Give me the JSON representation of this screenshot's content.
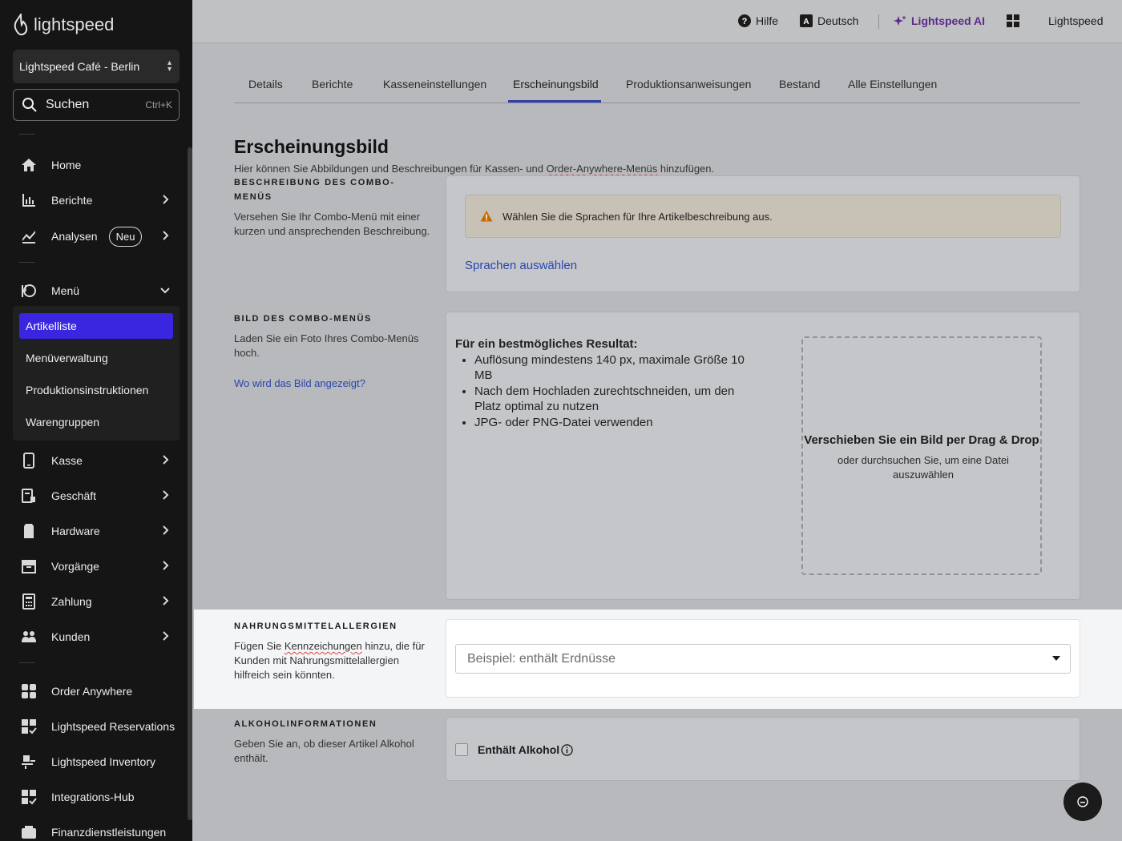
{
  "sidebar": {
    "logo_text": "lightspeed",
    "store_selector": "Lightspeed Café - Berlin",
    "search_label": "Suchen",
    "search_shortcut": "Ctrl+K",
    "items": [
      {
        "label": "Home"
      },
      {
        "label": "Berichte"
      },
      {
        "label": "Analysen",
        "badge": "Neu"
      },
      {
        "label": "Menü"
      },
      {
        "label": "Kasse"
      },
      {
        "label": "Geschäft"
      },
      {
        "label": "Hardware"
      },
      {
        "label": "Vorgänge"
      },
      {
        "label": "Zahlung"
      },
      {
        "label": "Kunden"
      },
      {
        "label": "Order Anywhere"
      },
      {
        "label": "Lightspeed Reservations"
      },
      {
        "label": "Lightspeed Inventory"
      },
      {
        "label": "Integrations-Hub"
      },
      {
        "label": "Finanzdienstleistungen"
      }
    ],
    "submenu": [
      {
        "label": "Artikelliste",
        "active": true
      },
      {
        "label": "Menüverwaltung"
      },
      {
        "label": "Produktionsinstruktionen"
      },
      {
        "label": "Warengruppen"
      }
    ]
  },
  "topbar": {
    "help": "Hilfe",
    "language": "Deutsch",
    "ai": "Lightspeed AI",
    "account": "Lightspeed"
  },
  "tabs": [
    "Details",
    "Berichte",
    "Kasseneinstellungen",
    "Erscheinungsbild",
    "Produktionsanweisungen",
    "Bestand",
    "Alle Einstellungen"
  ],
  "active_tab": "Erscheinungsbild",
  "page": {
    "title": "Erscheinungsbild",
    "subtitle_pre": "Hier können Sie Abbildungen und Beschreibungen für Kassen- und ",
    "subtitle_link": "Order-Anywhere-Menüs",
    "subtitle_post": " hinzufügen."
  },
  "sections": {
    "description": {
      "title": "BESCHREIBUNG DES COMBO-MENÜS",
      "desc": "Versehen Sie Ihr Combo-Menü mit einer kurzen und ansprechenden Beschreibung.",
      "warning": "Wählen Sie die Sprachen für Ihre Artikelbeschreibung aus.",
      "link": "Sprachen auswählen"
    },
    "image": {
      "title": "BILD DES COMBO-MENÜS",
      "desc": "Laden Sie ein Foto Ihres Combo-Menüs hoch.",
      "link": "Wo wird das Bild angezeigt?",
      "tips_title": "Für ein bestmögliches Resultat:",
      "tips": [
        "Auflösung mindestens 140 px, maximale Größe 10 MB",
        "Nach dem Hochladen zurechtschneiden, um den Platz optimal zu nutzen",
        "JPG- oder PNG-Datei verwenden"
      ],
      "drop_title": "Verschieben Sie ein Bild per Drag & Drop",
      "drop_sub": "oder durchsuchen Sie, um eine Datei auszuwählen"
    },
    "allergies": {
      "title": "NAHRUNGSMITTELALLERGIEN",
      "desc_pre": "Fügen Sie ",
      "desc_word": "Kennzeichungen",
      "desc_post": " hinzu, die für Kunden mit Nahrungsmittelallergien hilfreich sein könnten.",
      "placeholder": "Beispiel: enthält Erdnüsse"
    },
    "alcohol": {
      "title": "ALKOHOLINFORMATIONEN",
      "desc": "Geben Sie an, ob dieser Artikel Alkohol enthält.",
      "checkbox_label": "Enthält Alkohol",
      "checked": false
    }
  },
  "colors": {
    "accent": "#3a26e0",
    "link": "#2a45b0",
    "ai": "#5d2a88"
  }
}
